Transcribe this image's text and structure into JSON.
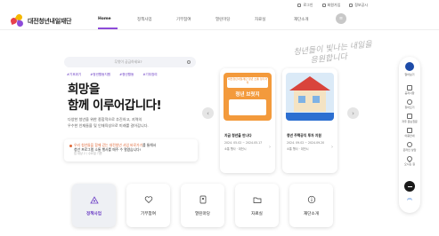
{
  "utility": {
    "login": "로그인",
    "signup": "회원가입",
    "sitemap": "정보공시"
  },
  "logo": {
    "name": "대전청년내일재단"
  },
  "nav": {
    "items": [
      "Home",
      "정책사업",
      "기부참여",
      "열린마당",
      "자료실",
      "재단소개"
    ],
    "active": "Home"
  },
  "search": {
    "placeholder": "무엇이 궁금하세요?"
  },
  "tags": [
    "#기후위기",
    "#청년활동지원",
    "#청년활동",
    "#기부참여"
  ],
  "hero": {
    "title_line1": "희망을",
    "title_line2": "함께 이루어갑니다!",
    "desc_line1": "다양한 청년을 위한 종합적으로 추진하고, 지역의",
    "desc_line2": "우수한 인재들을 및 인재육성으로 미래를 걸어갑니다."
  },
  "notice": {
    "line1_highlight": "우리 청년들을 함께 걷는 대전청년 사업 바로가기",
    "line1_rest": "를 통해서",
    "line2": "청년 프로그램 소통 행사를 매주 수 열렸습니다!",
    "meta": "접 대상 2 / 수요일 기준"
  },
  "slogan": {
    "line1": "청년들이 빛나는 내일을",
    "line2": "응원합니다"
  },
  "cards": [
    {
      "img_heading": "대전청년내일재단 청년 소통 정기자리",
      "img_title": "청년 브릿지",
      "title": "지금 청년을 만나다",
      "date": "2024. 05.02 ~ 2024.05.17",
      "tag": "소통 행사 · 대전시"
    },
    {
      "img_heading": "",
      "img_title": "",
      "title": "청년 주택공익 투자 지원",
      "date": "2024. 09.02 ~ 2024.09.20",
      "tag": "소통 행사 · 대전시"
    }
  ],
  "quick_menu": [
    "알아보기",
    "공지사항",
    "찾아오기",
    "자주 문는질문",
    "이용안내",
    "온라인 상담",
    "오시는 길"
  ],
  "tiles": [
    {
      "label": "정책사업",
      "icon": "policy-icon",
      "active": true
    },
    {
      "label": "기부참여",
      "icon": "heart-icon",
      "active": false
    },
    {
      "label": "열린마당",
      "icon": "board-icon",
      "active": false
    },
    {
      "label": "자료실",
      "icon": "folder-icon",
      "active": false
    },
    {
      "label": "재단소개",
      "icon": "info-icon",
      "active": false
    }
  ],
  "colors": {
    "accent": "#6a3cc4",
    "nav_indicator": "#8d4bd9",
    "orange": "#f08a2e",
    "blue": "#2c6fd1",
    "quick_dark": "#1a1a1a"
  }
}
